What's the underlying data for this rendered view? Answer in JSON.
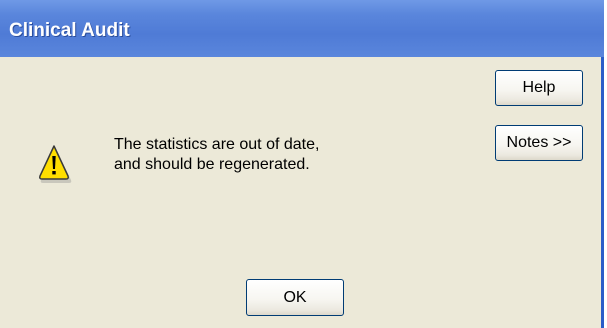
{
  "dialog": {
    "title": "Clinical Audit",
    "message_lines": [
      "The statistics are out of date,",
      "and should be regenerated."
    ],
    "icon": "warning-icon"
  },
  "buttons": {
    "help_label": "Help",
    "notes_label": "Notes >>",
    "ok_label": "OK"
  },
  "colors": {
    "titlebar": "#5a86dc",
    "dialog_background": "#ece9d8",
    "warning_fill": "#ffde00",
    "button_border": "#003c74"
  }
}
